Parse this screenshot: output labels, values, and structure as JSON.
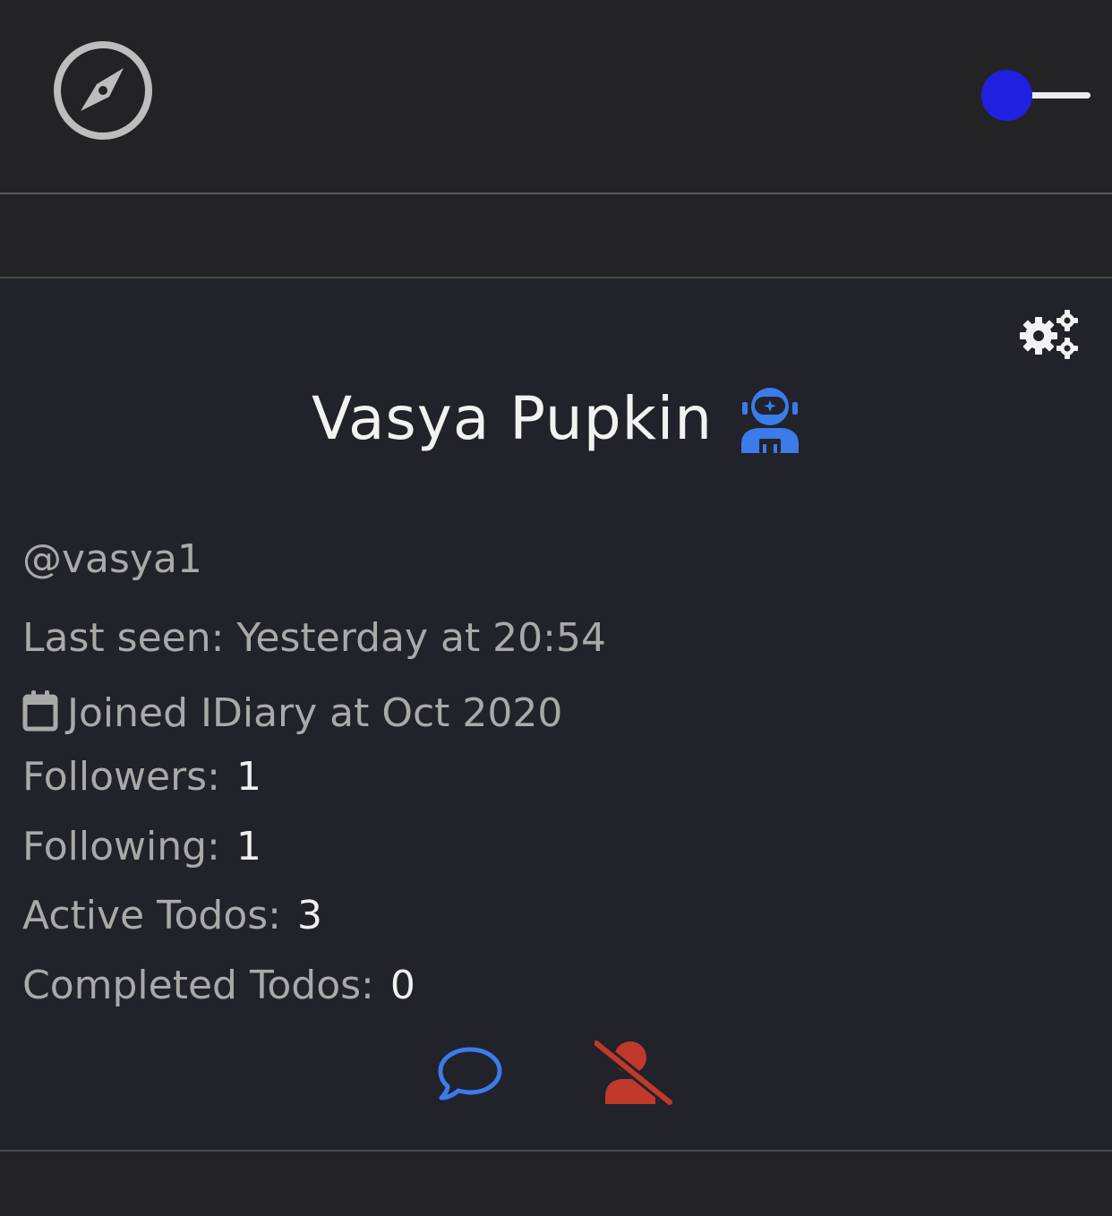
{
  "header": {
    "logo_icon": "compass-icon",
    "theme_toggle": {
      "state": "on",
      "knob_color": "#2020e0",
      "track_color": "#ececec"
    }
  },
  "profile": {
    "settings_icon": "cogs-icon",
    "name": "Vasya Pupkin",
    "avatar_icon": "user-astronaut-icon",
    "handle": "@vasya1",
    "last_seen": "Last seen: Yesterday at 20:54",
    "calendar_icon": "calendar-icon",
    "joined": "Joined IDiary at Oct 2020",
    "stats": {
      "followers_label": "Followers:",
      "followers_value": "1",
      "following_label": "Following:",
      "following_value": "1",
      "active_label": "Active Todos:",
      "active_value": "3",
      "completed_label": "Completed Todos:",
      "completed_value": "0"
    },
    "actions": {
      "message_icon": "comment-icon",
      "unfollow_icon": "user-slash-icon"
    }
  },
  "colors": {
    "background": "#232325",
    "card": "#22222b",
    "accent_blue": "#3b7bea",
    "danger_red": "#c0392b",
    "muted_text": "#a9a9a9"
  }
}
